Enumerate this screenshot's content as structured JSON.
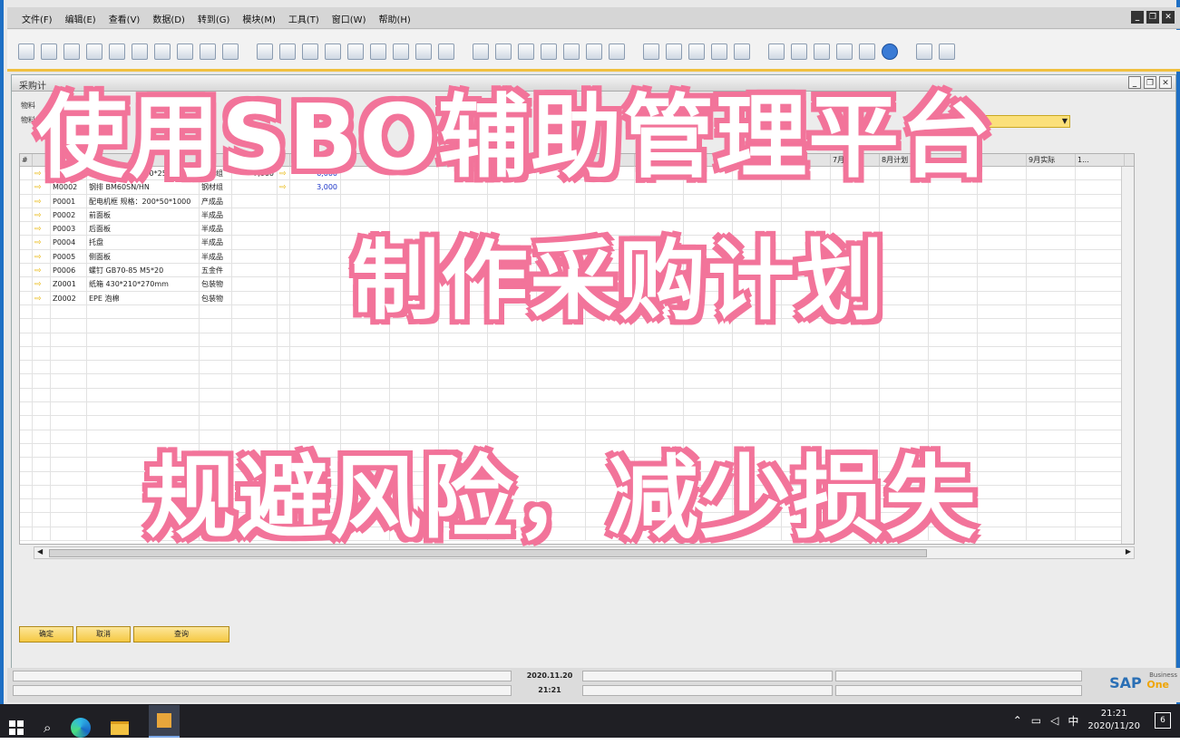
{
  "menubar": {
    "items": [
      "文件(F)",
      "编辑(E)",
      "查看(V)",
      "数据(D)",
      "转到(G)",
      "模块(M)",
      "工具(T)",
      "窗口(W)",
      "帮助(H)"
    ]
  },
  "window": {
    "title": "采购计"
  },
  "filters": {
    "row1_label": "物料",
    "row2_label": "物料"
  },
  "grid": {
    "headers": [
      "#",
      "",
      "物",
      "",
      "",
      "",
      "",
      "实际",
      "",
      "2月",
      "计划",
      "",
      "",
      "",
      "",
      "",
      "",
      "",
      "7月",
      "8月计划",
      "",
      "",
      "9月实际",
      "1...",
      ""
    ],
    "rows": [
      {
        "code": "M0001",
        "desc": "不锈钢板 1.0*1250*2500",
        "group": "钢材组",
        "plan": "7,000",
        "actual": "6,000"
      },
      {
        "code": "M0002",
        "desc": "钢排 BM60SN/HN",
        "group": "钢材组",
        "plan": "",
        "actual": "3,000"
      },
      {
        "code": "P0001",
        "desc": "配电机框 规格：200*50*1000",
        "group": "产成品",
        "plan": "",
        "actual": ""
      },
      {
        "code": "P0002",
        "desc": "前面板",
        "group": "半成品",
        "plan": "",
        "actual": ""
      },
      {
        "code": "P0003",
        "desc": "后面板",
        "group": "半成品",
        "plan": "",
        "actual": ""
      },
      {
        "code": "P0004",
        "desc": "托盘",
        "group": "半成品",
        "plan": "",
        "actual": ""
      },
      {
        "code": "P0005",
        "desc": "侧面板",
        "group": "半成品",
        "plan": "",
        "actual": ""
      },
      {
        "code": "P0006",
        "desc": "螺钉 GB70-85 M5*20",
        "group": "五金件",
        "plan": "",
        "actual": ""
      },
      {
        "code": "Z0001",
        "desc": "纸箱 430*210*270mm",
        "group": "包装物",
        "plan": "",
        "actual": ""
      },
      {
        "code": "Z0002",
        "desc": "EPE 泡棉",
        "group": "包装物",
        "plan": "",
        "actual": ""
      }
    ]
  },
  "buttons": {
    "ok": "确定",
    "cancel": "取消",
    "query": "查询"
  },
  "status": {
    "date": "2020.11.20",
    "time": "21:21"
  },
  "brand": {
    "sap": "SAP",
    "business": "Business",
    "one": "One"
  },
  "taskbar": {
    "clock_time": "21:21",
    "clock_date": "2020/11/20",
    "ime": "中",
    "notifications": "6"
  },
  "overlay": {
    "line1": "使用SBO辅助管理平台",
    "line2": "制作采购计划",
    "line3": "规避风险，减少损失"
  },
  "colors": {
    "overlay_outline": "#f2749a",
    "accent_yellow": "#f5c842",
    "frame_blue": "#1e6fc4"
  }
}
